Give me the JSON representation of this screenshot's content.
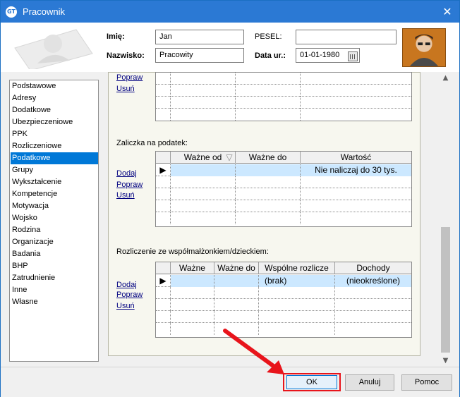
{
  "window": {
    "title": "Pracownik",
    "logo_text": "GT",
    "close_glyph": "✕"
  },
  "header": {
    "first_name_label": "Imię:",
    "first_name_value": "Jan",
    "last_name_label": "Nazwisko:",
    "last_name_value": "Pracowity",
    "pesel_label": "PESEL:",
    "pesel_value": "",
    "birth_label": "Data ur.:",
    "birth_value": "01-01-1980"
  },
  "sidebar": {
    "items": [
      {
        "label": "Podstawowe"
      },
      {
        "label": "Adresy"
      },
      {
        "label": "Dodatkowe"
      },
      {
        "label": "Ubezpieczeniowe"
      },
      {
        "label": "PPK"
      },
      {
        "label": "Rozliczeniowe"
      },
      {
        "label": "Podatkowe",
        "active": true
      },
      {
        "label": "Grupy"
      },
      {
        "label": "Wykształcenie"
      },
      {
        "label": "Kompetencje"
      },
      {
        "label": "Motywacja"
      },
      {
        "label": "Wojsko"
      },
      {
        "label": "Rodzina"
      },
      {
        "label": "Organizacje"
      },
      {
        "label": "Badania"
      },
      {
        "label": "BHP"
      },
      {
        "label": "Zatrudnienie"
      },
      {
        "label": "Inne"
      },
      {
        "label": "Własne"
      }
    ]
  },
  "section1": {
    "actions": {
      "edit": "Popraw",
      "delete": "Usuń"
    }
  },
  "section2": {
    "title": "Zaliczka na podatek:",
    "actions": {
      "add": "Dodaj",
      "edit": "Popraw",
      "delete": "Usuń"
    },
    "columns": [
      "Ważne od",
      "Ważne do",
      "Wartość"
    ],
    "rows": [
      {
        "from": "",
        "to": "",
        "value": "Nie naliczaj do 30 tys."
      }
    ]
  },
  "section3": {
    "title": "Rozliczenie ze współmałżonkiem/dzieckiem:",
    "actions": {
      "add": "Dodaj",
      "edit": "Popraw",
      "delete": "Usuń"
    },
    "columns": [
      "Ważne",
      "Ważne do",
      "Wspólne rozlicze",
      "Dochody"
    ],
    "rows": [
      {
        "from": "",
        "to": "",
        "joint": "(brak)",
        "income": "(nieokreślone)"
      }
    ]
  },
  "buttons": {
    "ok": "OK",
    "cancel": "Anuluj",
    "help": "Pomoc"
  },
  "icons": {
    "row_indicator": "▶",
    "scroll_up": "▲",
    "scroll_down": "▼",
    "sort": "▽"
  },
  "colors": {
    "titlebar": "#2b79d4",
    "selection": "#0078d7",
    "highlight_frame": "#e8141b"
  }
}
